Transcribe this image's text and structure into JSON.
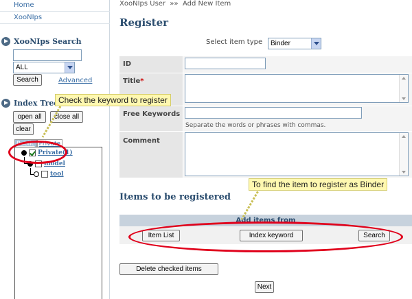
{
  "sidebar": {
    "links": [
      "Home",
      "XooNIps"
    ],
    "search": {
      "title": "XooNIps Search",
      "query_value": "",
      "scope_value": "ALL",
      "search_button": "Search",
      "advanced_link": "Advanced"
    },
    "tree": {
      "title": "Index Tree",
      "open_all": "open all",
      "close_all": "close all",
      "clear": "clear",
      "tabs": [
        "Public",
        "Private"
      ],
      "nodes": [
        {
          "label": "Private(1)",
          "checked": true
        },
        {
          "label": "model",
          "checked": false
        },
        {
          "label": "tool",
          "checked": false
        }
      ]
    }
  },
  "main": {
    "breadcrumb": "XooNIps User  »»  Add New Item",
    "title": "Register",
    "item_type": {
      "label": "Select item type",
      "value": "Binder"
    },
    "form": {
      "id_label": "ID",
      "id_value": "",
      "title_label": "Title",
      "required_mark": "*",
      "title_value": "",
      "keywords_label": "Free Keywords",
      "keywords_value": "",
      "keywords_hint": "Separate the words or phrases with commas.",
      "comment_label": "Comment",
      "comment_value": ""
    },
    "items_section": {
      "title": "Items to be registered",
      "add_header": "Add items from",
      "item_list_button": "Item List",
      "index_keyword_button": "Index keyword",
      "search_button": "Search",
      "delete_button": "Delete checked items",
      "next_button": "Next"
    }
  },
  "callouts": {
    "keyword": "Check the keyword to register",
    "binder": "To find the item to register as Binder"
  },
  "colors": {
    "heading": "#2a4c6e",
    "link": "#3a6ea5",
    "highlight": "#e0001b",
    "callout_bg": "#fff8b0"
  }
}
